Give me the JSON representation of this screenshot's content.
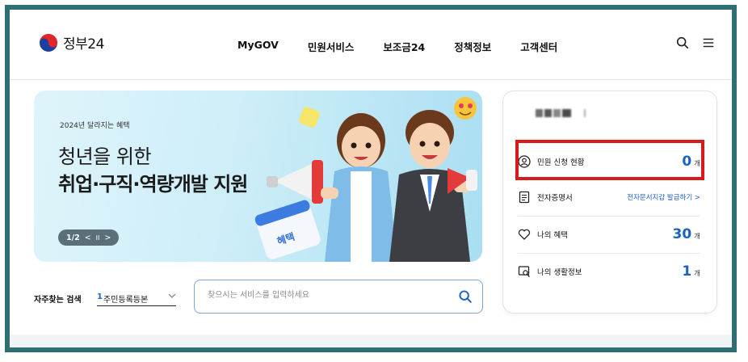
{
  "header": {
    "logo_text": "정부24",
    "nav": [
      "MyGOV",
      "민원서비스",
      "보조금24",
      "정책정보",
      "고객센터"
    ]
  },
  "banner": {
    "eyebrow": "2024년 달라지는 혜택",
    "title_line1": "청년을 위한",
    "title_line2": "취업·구직·역량개발 지원",
    "pager": "1/2",
    "pager_prev": "<",
    "pager_pause": "II",
    "pager_next": ">",
    "badge": "혜택"
  },
  "search": {
    "frequent_label": "자주찾는 검색",
    "frequent_num": "1",
    "frequent_text": "주민등록등본",
    "placeholder": "찾으시는 서비스를 입력하세요"
  },
  "panel": {
    "rows": [
      {
        "label": "민원 신청 현황",
        "count": "0",
        "unit": "개"
      },
      {
        "label": "전자증명서",
        "link": "전자문서지갑 발급하기 >"
      },
      {
        "label": "나의 혜택",
        "count": "30",
        "unit": "개"
      },
      {
        "label": "나의 생활정보",
        "count": "1",
        "unit": "개"
      }
    ]
  },
  "colors": {
    "frame": "#2f6f73",
    "accent_blue": "#1c63c7",
    "highlight_red": "#d81a1a"
  }
}
